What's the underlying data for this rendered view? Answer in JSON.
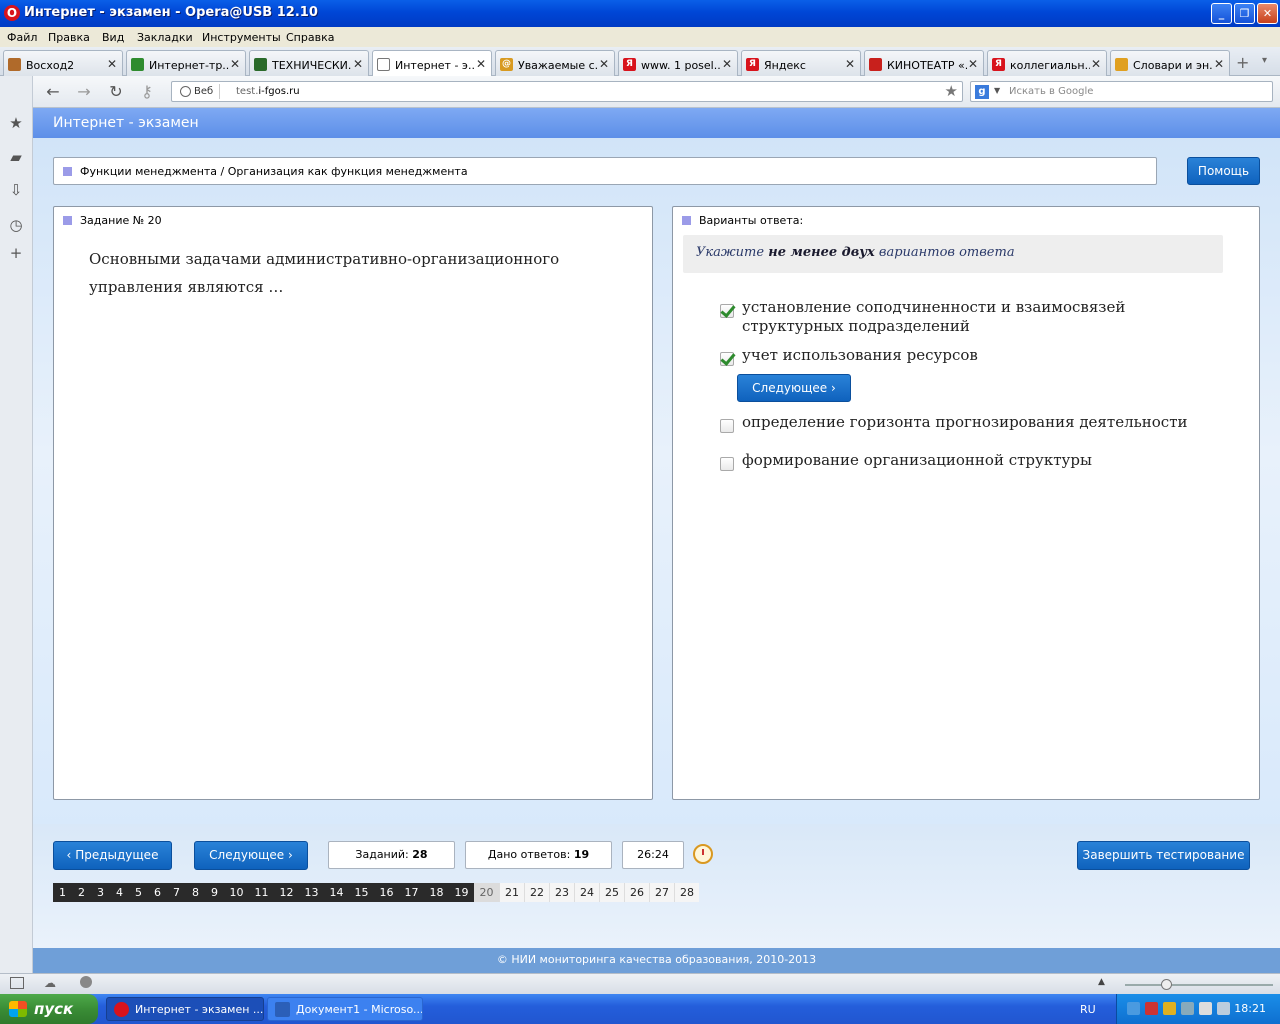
{
  "window": {
    "title": "Интернет - экзамен - Opera@USB 12.10"
  },
  "menu": [
    "Файл",
    "Правка",
    "Вид",
    "Закладки",
    "Инструменты",
    "Справка"
  ],
  "tabs": [
    {
      "label": "Восход2",
      "color": "#b06a2a",
      "glyph": "",
      "active": false
    },
    {
      "label": "Интернет-тр...",
      "color": "#2e8b2e",
      "glyph": "",
      "active": false
    },
    {
      "label": "ТЕХНИЧЕСКИ...",
      "color": "#2a6a2a",
      "glyph": "",
      "active": false
    },
    {
      "label": "Интернет - э...",
      "color": "#ffffff",
      "glyph": "",
      "active": true
    },
    {
      "label": "Уважаемые с...",
      "color": "#d89a20",
      "glyph": "@",
      "active": false
    },
    {
      "label": "www. 1 posel...",
      "color": "#d8131c",
      "glyph": "Я",
      "active": false
    },
    {
      "label": "Яндекс",
      "color": "#d8131c",
      "glyph": "Я",
      "active": false
    },
    {
      "label": "КИНОТЕАТР «...",
      "color": "#c8201c",
      "glyph": "",
      "active": false
    },
    {
      "label": "коллегиальн...",
      "color": "#d8131c",
      "glyph": "Я",
      "active": false
    },
    {
      "label": "Словари и эн...",
      "color": "#e0a020",
      "glyph": "",
      "active": false
    }
  ],
  "address": {
    "web_label": "Веб",
    "url_prefix": "test.",
    "url_domain": "i-fgos.ru",
    "search_placeholder": "Искать в Google",
    "search_engine": "g"
  },
  "page": {
    "header_title": "Интернет - экзамен",
    "breadcrumb": "Функции менеджмента / Организация как функция менеджмента",
    "help_label": "Помощь",
    "task_label": "Задание № 20",
    "question_text": "Основными задачами административно-организационного управления являются …",
    "answers_label": "Варианты ответа:",
    "instruction_pre": "Укажите ",
    "instruction_bold": "не менее двух",
    "instruction_post": " вариантов ответа",
    "options": [
      {
        "text": "установление соподчиненности и взаимосвязей структурных подразделений",
        "checked": true
      },
      {
        "text": "учет использования ресурсов",
        "checked": true
      },
      {
        "text": "определение горизонта прогнозирования деятельности",
        "checked": false
      },
      {
        "text": "формирование организационной структуры",
        "checked": false
      }
    ],
    "inline_next_label": "Следующее",
    "prev_label": "Предыдущее",
    "next_label": "Следующее",
    "tasks_label": "Заданий:",
    "tasks_count": "28",
    "answered_label": "Дано ответов:",
    "answered_count": "19",
    "timer": "26:24",
    "finish_label": "Завершить тестирование",
    "question_numbers": [
      "1",
      "2",
      "3",
      "4",
      "5",
      "6",
      "7",
      "8",
      "9",
      "10",
      "11",
      "12",
      "13",
      "14",
      "15",
      "16",
      "17",
      "18",
      "19",
      "20",
      "21",
      "22",
      "23",
      "24",
      "25",
      "26",
      "27",
      "28"
    ],
    "answered_up_to": 19,
    "current_question": 20,
    "footer": "© НИИ мониторинга качества образования, 2010-2013"
  },
  "taskbar": {
    "start_label": "пуск",
    "items": [
      {
        "label": "Интернет - экзамен ...",
        "icon_color": "#d8131c",
        "active": true
      },
      {
        "label": "Документ1 - Microso...",
        "icon_color": "#2b5fb8",
        "active": false
      }
    ],
    "lang": "RU",
    "time": "18:21"
  },
  "colors": {
    "accent_blue": "#1466c4",
    "header_blue": "#6b9cee",
    "check_green": "#2e8b2e"
  }
}
